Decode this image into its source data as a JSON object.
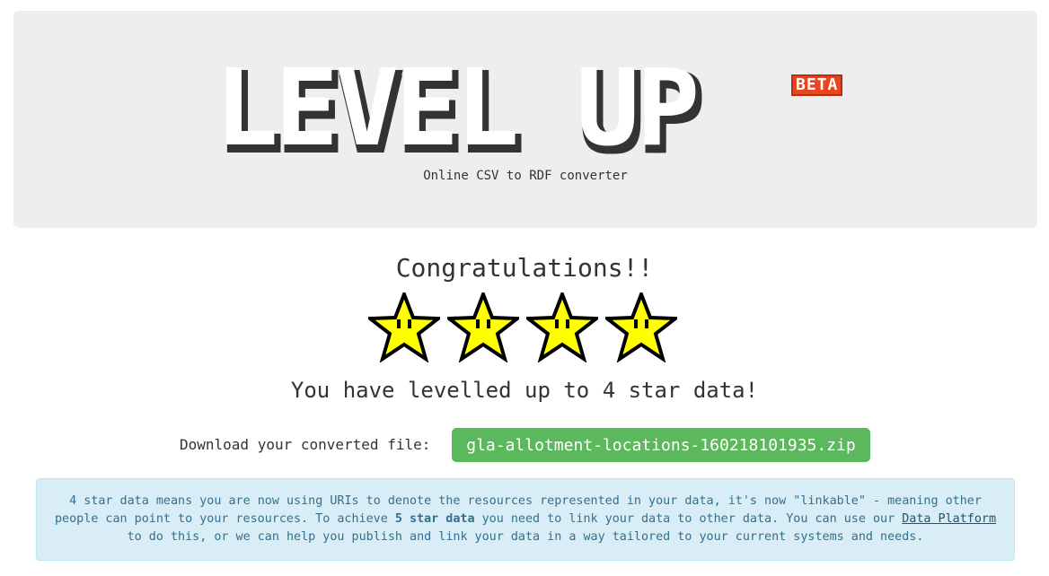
{
  "header": {
    "logo_text": "LEVEL UP",
    "badge": "BETA",
    "tagline": "Online CSV to RDF converter"
  },
  "result": {
    "congrats": "Congratulations!!",
    "star_rating": 4,
    "message": "You have levelled up to 4 star data!",
    "download_label": "Download your converted file:",
    "download_file": "gla-allotment-locations-160218101935.zip"
  },
  "info": {
    "text_1": "4 star data means you are now using URIs to denote the resources represented in your data, it's now \"linkable\" - meaning other people can point to your resources. To achieve ",
    "bold": "5 star data",
    "text_2": " you need to link your data to other data. You can use our ",
    "link": "Data Platform",
    "text_3": " to do this, or we can help you publish and link your data in a way tailored to your current systems and needs."
  },
  "colors": {
    "hero_bg": "#eeeeee",
    "button": "#5cb85c",
    "info_bg": "#d9edf7",
    "info_text": "#31708f",
    "star_fill": "#ffff00",
    "badge": "#e8461e"
  },
  "icons": {
    "star": "pixel-star-face-icon"
  }
}
